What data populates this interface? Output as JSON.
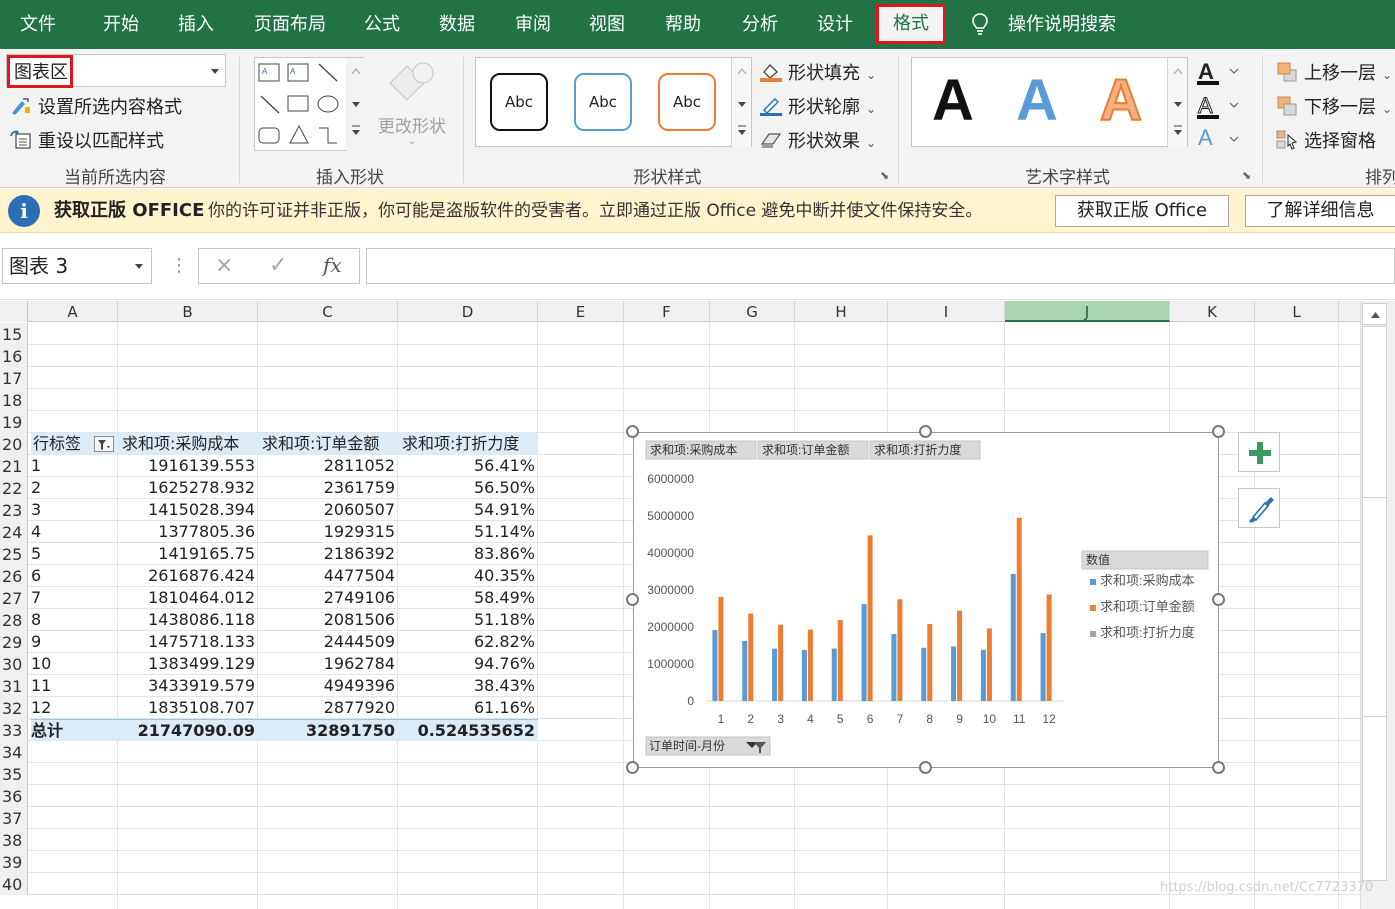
{
  "ribbon_tabs": {
    "file": "文件",
    "home": "开始",
    "insert": "插入",
    "layout": "页面布局",
    "formulas": "公式",
    "data": "数据",
    "review": "审阅",
    "view": "视图",
    "help": "帮助",
    "analyze": "分析",
    "design": "设计",
    "format": "格式",
    "search": "操作说明搜索"
  },
  "ribbon": {
    "current_selection": {
      "combo_value": "图表区",
      "format_selection": "设置所选内容格式",
      "reset_style": "重设以匹配样式",
      "label": "当前所选内容"
    },
    "insert_shapes": {
      "change_shape": "更改形状",
      "label": "插入形状"
    },
    "shape_styles": {
      "swatch_text": "Abc",
      "fill": "形状填充",
      "outline": "形状轮廓",
      "effects": "形状效果",
      "label": "形状样式"
    },
    "wordart_styles": {
      "letter": "A",
      "label": "艺术字样式"
    },
    "arrange": {
      "bring_forward": "上移一层",
      "send_backward": "下移一层",
      "selection_pane": "选择窗格",
      "label": "排列"
    }
  },
  "notice": {
    "title": "获取正版 OFFICE",
    "message": "你的许可证并非正版，你可能是盗版软件的受害者。立即通过正版 Office 避免中断并使文件保持安全。",
    "get_genuine": "获取正版 Office",
    "learn_more": "了解详细信息"
  },
  "formula_bar": {
    "name_box": "图表 3",
    "cancel_icon": "×",
    "enter_icon": "✓",
    "fx": "fx"
  },
  "columns": [
    "A",
    "B",
    "C",
    "D",
    "E",
    "F",
    "G",
    "H",
    "I",
    "J",
    "K",
    "L"
  ],
  "selected_column": "J",
  "rows": [
    "15",
    "16",
    "17",
    "18",
    "19",
    "20",
    "21",
    "22",
    "23",
    "24",
    "25",
    "26",
    "27",
    "28",
    "29",
    "30",
    "31",
    "32",
    "33",
    "34",
    "35",
    "36",
    "37",
    "38",
    "39",
    "40"
  ],
  "pivot": {
    "headers": [
      "行标签",
      "求和项:采购成本",
      "求和项:订单金额",
      "求和项:打折力度"
    ],
    "rows": [
      [
        "1",
        "1916139.553",
        "2811052",
        "56.41%"
      ],
      [
        "2",
        "1625278.932",
        "2361759",
        "56.50%"
      ],
      [
        "3",
        "1415028.394",
        "2060507",
        "54.91%"
      ],
      [
        "4",
        "1377805.36",
        "1929315",
        "51.14%"
      ],
      [
        "5",
        "1419165.75",
        "2186392",
        "83.86%"
      ],
      [
        "6",
        "2616876.424",
        "4477504",
        "40.35%"
      ],
      [
        "7",
        "1810464.012",
        "2749106",
        "58.49%"
      ],
      [
        "8",
        "1438086.118",
        "2081506",
        "51.18%"
      ],
      [
        "9",
        "1475718.133",
        "2444509",
        "62.82%"
      ],
      [
        "10",
        "1383499.129",
        "1962784",
        "94.76%"
      ],
      [
        "11",
        "3433919.579",
        "4949396",
        "38.43%"
      ],
      [
        "12",
        "1835108.707",
        "2877920",
        "61.16%"
      ]
    ],
    "total": [
      "总计",
      "21747090.09",
      "32891750",
      "0.524535652"
    ]
  },
  "chart_data": {
    "type": "bar",
    "field_buttons": [
      "求和项:采购成本",
      "求和项:订单金额",
      "求和项:打折力度"
    ],
    "axis_field_button": "订单时间-月份",
    "legend_title": "数值",
    "legend_position": "right",
    "categories": [
      "1",
      "2",
      "3",
      "4",
      "5",
      "6",
      "7",
      "8",
      "9",
      "10",
      "11",
      "12"
    ],
    "series": [
      {
        "name": "求和项:采购成本",
        "color": "#5b9bd5",
        "values": [
          1916139.553,
          1625278.932,
          1415028.394,
          1377805.36,
          1419165.75,
          2616876.424,
          1810464.012,
          1438086.118,
          1475718.133,
          1383499.129,
          3433919.579,
          1835108.707
        ]
      },
      {
        "name": "求和项:订单金额",
        "color": "#ed7d31",
        "values": [
          2811052,
          2361759,
          2060507,
          1929315,
          2186392,
          4477504,
          2749106,
          2081506,
          2444509,
          1962784,
          4949396,
          2877920
        ]
      },
      {
        "name": "求和项:打折力度",
        "color": "#a5a5a5",
        "values": [
          0.5641,
          0.565,
          0.5491,
          0.5114,
          0.8386,
          0.4035,
          0.5849,
          0.5118,
          0.6282,
          0.9476,
          0.3843,
          0.6116
        ]
      }
    ],
    "ylim": [
      0,
      6000000
    ],
    "yticks": [
      "0",
      "1000000",
      "2000000",
      "3000000",
      "4000000",
      "5000000",
      "6000000"
    ],
    "grid": false
  },
  "colors": {
    "ribbon_green": "#217346",
    "highlight_red": "#e3141b",
    "notice_bg": "#fff4ce",
    "pivot_header_bg": "#ddebf7"
  },
  "watermark": "https://blog.csdn.net/Cc7723370"
}
